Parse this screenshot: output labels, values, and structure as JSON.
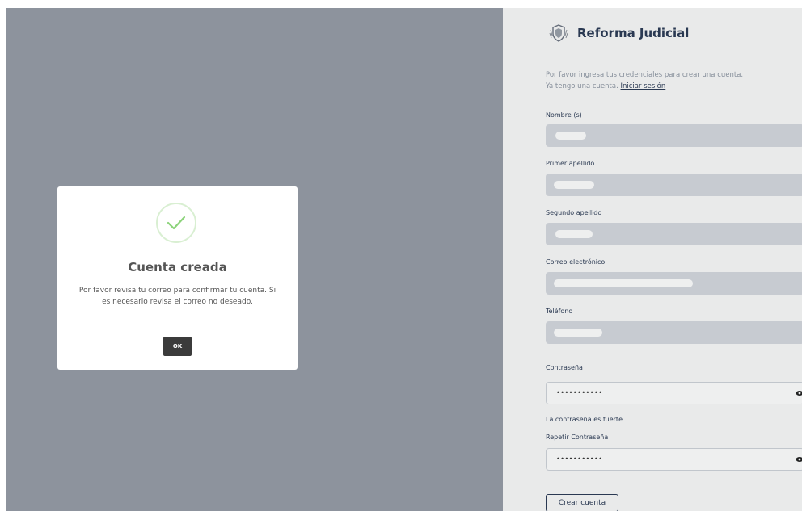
{
  "brand": {
    "title": "Reforma Judicial"
  },
  "intro": {
    "line1": "Por favor ingresa tus credenciales para crear una cuenta.",
    "line2_prefix": "Ya tengo una cuenta. ",
    "login_link": "Iniciar sesión"
  },
  "fields": {
    "nombre_label": "Nombre (s)",
    "primer_apellido_label": "Primer apellido",
    "segundo_apellido_label": "Segundo apellido",
    "correo_label": "Correo electrónico",
    "telefono_label": "Teléfono",
    "contrasena_label": "Contraseña",
    "contrasena_value": "•••••••••••",
    "strength_text": "La contraseña es fuerte.",
    "repetir_label": "Repetir Contraseña",
    "repetir_value": "•••••••••••"
  },
  "submit_label": "Crear cuenta",
  "modal": {
    "title": "Cuenta creada",
    "message": "Por favor revisa tu correo para confirmar tu cuenta. Si es necesario revisa el correo no deseado.",
    "ok_label": "OK"
  },
  "colors": {
    "overlay_gray": "#8d939d",
    "brand_navy": "#2b3a55",
    "success_green": "#8cd37a",
    "ok_button": "#3b3b3b"
  }
}
